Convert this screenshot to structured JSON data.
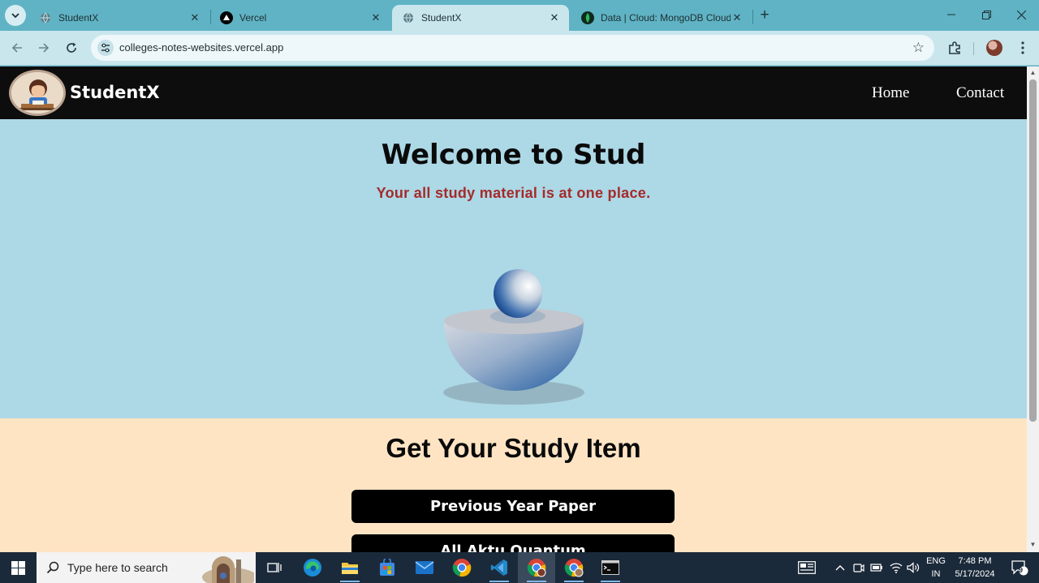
{
  "browser": {
    "tabs": [
      {
        "title": "StudentX",
        "active": false
      },
      {
        "title": "Vercel",
        "active": false
      },
      {
        "title": "StudentX",
        "active": true
      },
      {
        "title": "Data | Cloud: MongoDB Cloud",
        "active": false
      }
    ],
    "url": "colleges-notes-websites.vercel.app"
  },
  "site": {
    "brand": "StudentX",
    "nav": {
      "home": "Home",
      "contact": "Contact"
    },
    "hero": {
      "title": "Welcome to Stud",
      "subtitle": "Your all study material is at one place."
    },
    "study": {
      "title": "Get Your Study Item",
      "buttons": [
        "Previous Year Paper",
        "All Aktu Quantum"
      ]
    }
  },
  "taskbar": {
    "search_placeholder": "Type here to search",
    "lang_top": "ENG",
    "lang_bottom": "IN",
    "time": "7:48 PM",
    "date": "5/17/2024",
    "notification_count": "9"
  },
  "colors": {
    "hero_bg": "#add8e6",
    "study_bg": "#ffe4c4",
    "nav_bg": "#0d0d0d",
    "subtitle": "#a52a2a",
    "chrome_tabstrip": "#5fb3c4"
  }
}
